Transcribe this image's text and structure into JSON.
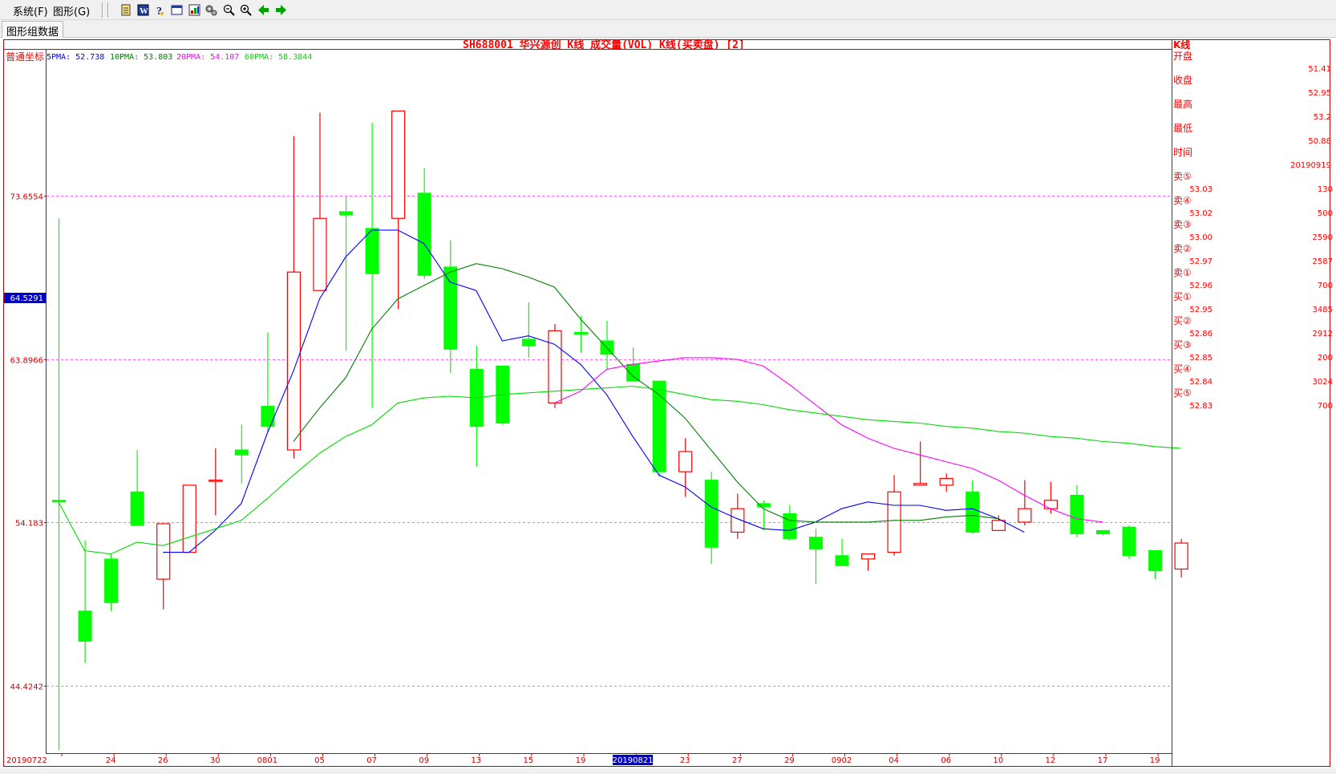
{
  "menu": {
    "system": "系统(F)",
    "graph": "图形(G)"
  },
  "toolbar": [
    "doc-icon",
    "word-icon",
    "help-icon",
    "window-icon",
    "image-icon",
    "gears-icon",
    "zoom-out-icon",
    "zoom-in-icon",
    "back-arrow-icon",
    "forward-arrow-icon"
  ],
  "tab": {
    "label": "图形组数据"
  },
  "chart_header": {
    "title": "SH688001 华兴源创 K线 成交量(VOL) K线(买卖盘) [2]",
    "coord_mode": "普通坐标",
    "cursor_price": "64.5291",
    "cursor_date": "20190821"
  },
  "right_panel": {
    "header": "K线",
    "fields": [
      {
        "label": "开盘",
        "value": "51.41"
      },
      {
        "label": "收盘",
        "value": "52.95"
      },
      {
        "label": "最高",
        "value": "53.2"
      },
      {
        "label": "最低",
        "value": "50.88"
      },
      {
        "label": "时间",
        "value": "20190919"
      }
    ],
    "orderbook": [
      {
        "label": "卖⑤",
        "price": "53.03",
        "volume": "130"
      },
      {
        "label": "卖④",
        "price": "53.02",
        "volume": "500"
      },
      {
        "label": "卖③",
        "price": "53.00",
        "volume": "2590"
      },
      {
        "label": "卖②",
        "price": "52.97",
        "volume": "2587"
      },
      {
        "label": "卖①",
        "price": "52.96",
        "volume": "700"
      },
      {
        "label": "买①",
        "price": "52.95",
        "volume": "3485"
      },
      {
        "label": "买②",
        "price": "52.86",
        "volume": "2912"
      },
      {
        "label": "买③",
        "price": "52.85",
        "volume": "200"
      },
      {
        "label": "买④",
        "price": "52.84",
        "volume": "3024"
      },
      {
        "label": "买⑤",
        "price": "52.83",
        "volume": "700"
      }
    ]
  },
  "colors": {
    "border": "#cc0000",
    "up": "#ff0000",
    "down": "#00ff00",
    "grid": "#ff66ff",
    "ma5": "#0000ff",
    "ma10": "#008000",
    "ma20": "#ff00ff",
    "ma60": "#00dd00",
    "cursor_bg": "#0000cc"
  },
  "chart_data": {
    "type": "candlestick",
    "title": "SH688001 华兴源创 K线 成交量(VOL) K线(买卖盘) [2]",
    "ylim": [
      40.43,
      82.35
    ],
    "yticks": [
      {
        "label": "73.6554",
        "value": 73.6554
      },
      {
        "label": "63.8966",
        "value": 63.8966
      },
      {
        "label": "54.183",
        "value": 54.183
      },
      {
        "label": "44.4242",
        "value": 44.4242
      }
    ],
    "xticks": [
      {
        "i": 0,
        "label": "20190722"
      },
      {
        "i": 2,
        "label": "24"
      },
      {
        "i": 4,
        "label": "26"
      },
      {
        "i": 6,
        "label": "30"
      },
      {
        "i": 8,
        "label": "0801"
      },
      {
        "i": 10,
        "label": "05"
      },
      {
        "i": 12,
        "label": "07"
      },
      {
        "i": 14,
        "label": "09"
      },
      {
        "i": 16,
        "label": "13"
      },
      {
        "i": 18,
        "label": "15"
      },
      {
        "i": 20,
        "label": "19"
      },
      {
        "i": 22,
        "label": "20190821"
      },
      {
        "i": 24,
        "label": "23"
      },
      {
        "i": 26,
        "label": "27"
      },
      {
        "i": 28,
        "label": "29"
      },
      {
        "i": 30,
        "label": "0902"
      },
      {
        "i": 32,
        "label": "04"
      },
      {
        "i": 34,
        "label": "06"
      },
      {
        "i": 36,
        "label": "10"
      },
      {
        "i": 38,
        "label": "12"
      },
      {
        "i": 40,
        "label": "17"
      },
      {
        "i": 42,
        "label": "19"
      }
    ],
    "candles": [
      {
        "o": 55.5,
        "h": 72.3,
        "l": 40.6,
        "c": 55.4
      },
      {
        "o": 48.9,
        "h": 53.1,
        "l": 45.8,
        "c": 47.1
      },
      {
        "o": 52.0,
        "h": 52.3,
        "l": 48.9,
        "c": 49.4
      },
      {
        "o": 56.0,
        "h": 58.5,
        "l": 54.0,
        "c": 54.0
      },
      {
        "o": 50.8,
        "h": 51.1,
        "l": 49.0,
        "c": 54.1
      },
      {
        "o": 52.4,
        "h": 56.4,
        "l": 52.4,
        "c": 56.4
      },
      {
        "o": 56.7,
        "h": 58.6,
        "l": 54.6,
        "c": 56.7
      },
      {
        "o": 58.5,
        "h": 60.0,
        "l": 56.5,
        "c": 58.2
      },
      {
        "o": 61.1,
        "h": 65.5,
        "l": 59.6,
        "c": 59.9
      },
      {
        "o": 58.5,
        "h": 77.2,
        "l": 58.0,
        "c": 69.1
      },
      {
        "o": 68.0,
        "h": 78.6,
        "l": 68.0,
        "c": 72.3
      },
      {
        "o": 72.7,
        "h": 73.6,
        "l": 64.4,
        "c": 72.5
      },
      {
        "o": 71.7,
        "h": 78.0,
        "l": 61.0,
        "c": 69.0
      },
      {
        "o": 72.3,
        "h": 78.4,
        "l": 66.9,
        "c": 78.7
      },
      {
        "o": 73.8,
        "h": 75.3,
        "l": 68.7,
        "c": 68.9
      },
      {
        "o": 69.4,
        "h": 71.0,
        "l": 63.1,
        "c": 64.5
      },
      {
        "o": 63.3,
        "h": 64.7,
        "l": 57.5,
        "c": 59.9
      },
      {
        "o": 63.5,
        "h": 63.5,
        "l": 60.0,
        "c": 60.1
      },
      {
        "o": 65.1,
        "h": 67.3,
        "l": 64.0,
        "c": 64.7
      },
      {
        "o": 61.3,
        "h": 66.0,
        "l": 61.0,
        "c": 65.6
      },
      {
        "o": 65.5,
        "h": 66.5,
        "l": 64.3,
        "c": 65.4
      },
      {
        "o": 65.0,
        "h": 66.2,
        "l": 63.3,
        "c": 64.2
      },
      {
        "o": 63.6,
        "h": 64.6,
        "l": 63.4,
        "c": 62.6
      },
      {
        "o": 62.6,
        "h": 62.6,
        "l": 56.9,
        "c": 57.2
      },
      {
        "o": 57.2,
        "h": 59.2,
        "l": 55.7,
        "c": 58.4
      },
      {
        "o": 56.7,
        "h": 57.2,
        "l": 51.7,
        "c": 52.7
      },
      {
        "o": 53.6,
        "h": 55.9,
        "l": 53.2,
        "c": 55.0
      },
      {
        "o": 55.3,
        "h": 55.5,
        "l": 53.7,
        "c": 55.1
      },
      {
        "o": 54.7,
        "h": 55.2,
        "l": 53.1,
        "c": 53.2
      },
      {
        "o": 53.3,
        "h": 53.8,
        "l": 50.5,
        "c": 52.6
      },
      {
        "o": 52.2,
        "h": 53.2,
        "l": 51.8,
        "c": 51.6
      },
      {
        "o": 52.0,
        "h": 52.3,
        "l": 51.3,
        "c": 52.3
      },
      {
        "o": 52.4,
        "h": 57.0,
        "l": 52.2,
        "c": 56.0
      },
      {
        "o": 56.4,
        "h": 59.0,
        "l": 56.4,
        "c": 56.5
      },
      {
        "o": 56.4,
        "h": 57.1,
        "l": 56.0,
        "c": 56.8
      },
      {
        "o": 56.0,
        "h": 56.7,
        "l": 53.5,
        "c": 53.6
      },
      {
        "o": 53.7,
        "h": 54.6,
        "l": 53.7,
        "c": 54.3
      },
      {
        "o": 54.2,
        "h": 56.7,
        "l": 54.0,
        "c": 55.0
      },
      {
        "o": 55.0,
        "h": 56.6,
        "l": 54.7,
        "c": 55.5
      },
      {
        "o": 55.8,
        "h": 56.4,
        "l": 53.3,
        "c": 53.5
      },
      {
        "o": 53.7,
        "h": 53.7,
        "l": 53.4,
        "c": 53.5
      },
      {
        "o": 53.9,
        "h": 54.0,
        "l": 52.0,
        "c": 52.2
      },
      {
        "o": 52.5,
        "h": 52.5,
        "l": 50.8,
        "c": 51.3
      },
      {
        "o": 51.4,
        "h": 53.2,
        "l": 50.9,
        "c": 52.95
      }
    ],
    "series": [
      {
        "name": "5PMA",
        "value_label": "52.738",
        "start": 4,
        "values": [
          52.4,
          52.4,
          53.7,
          55.3,
          59.5,
          63.2,
          67.5,
          70.0,
          71.6,
          71.6,
          70.8,
          68.5,
          68.0,
          65.0,
          65.3,
          64.8,
          63.6,
          61.8,
          59.3,
          57.0,
          56.3,
          55.1,
          54.4,
          53.8,
          53.7,
          54.2,
          55.0,
          55.4,
          55.2,
          55.2,
          54.9,
          55.0,
          54.4,
          53.6
        ]
      },
      {
        "name": "10PMA",
        "value_label": "53.803",
        "start": 9,
        "values": [
          59.0,
          61.0,
          62.8,
          65.7,
          67.5,
          68.3,
          69.1,
          69.6,
          69.3,
          68.8,
          68.2,
          66.3,
          64.6,
          62.9,
          61.8,
          60.4,
          58.5,
          56.6,
          55.0,
          54.3,
          54.2,
          54.2,
          54.2,
          54.3,
          54.3,
          54.5,
          54.6,
          54.4
        ]
      },
      {
        "name": "20PMA",
        "value_label": "54.107",
        "start": 19,
        "values": [
          61.3,
          62.0,
          63.3,
          63.6,
          63.8,
          64.0,
          64.0,
          63.9,
          63.5,
          62.4,
          61.2,
          60.0,
          59.2,
          58.6,
          58.2,
          57.8,
          57.4,
          56.7,
          55.8,
          55.0,
          54.4,
          54.2
        ]
      },
      {
        "name": "60PMA",
        "value_label": "58.3844",
        "start": 0,
        "values": [
          55.4,
          52.5,
          52.3,
          53.0,
          52.8,
          53.3,
          53.8,
          54.3,
          55.6,
          57.0,
          58.3,
          59.3,
          60.0,
          61.3,
          61.6,
          61.7,
          61.6,
          61.8,
          61.9,
          62.0,
          62.1,
          62.2,
          62.3,
          62.1,
          61.8,
          61.5,
          61.4,
          61.2,
          60.9,
          60.7,
          60.5,
          60.3,
          60.2,
          60.1,
          59.9,
          59.8,
          59.6,
          59.5,
          59.3,
          59.2,
          59.0,
          58.9,
          58.7,
          58.6
        ]
      }
    ]
  }
}
